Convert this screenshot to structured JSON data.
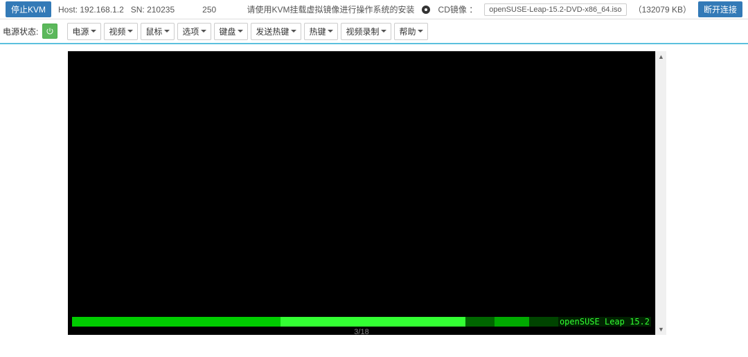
{
  "topbar": {
    "stop_kvm": "停止KVM",
    "host_label": "Host: 192.168.1.2",
    "sn_label": "SN: 210235",
    "num": "250",
    "instruction": "请使用KVM挂载虚拟镜像进行操作系统的安装",
    "cd_label": "CD镜像 ：",
    "iso_name": "openSUSE-Leap-15.2-DVD-x86_64.iso",
    "iso_size": "（132079 KB）",
    "disconnect": "断开连接"
  },
  "toolbar": {
    "power_status": "电源状态:",
    "menus": [
      "电源",
      "视频",
      "鼠标",
      "选项",
      "键盘",
      "发送热键",
      "热键",
      "视频录制",
      "帮助"
    ]
  },
  "console": {
    "os_label": "openSUSE Leap 15.2",
    "page": "3/18"
  }
}
